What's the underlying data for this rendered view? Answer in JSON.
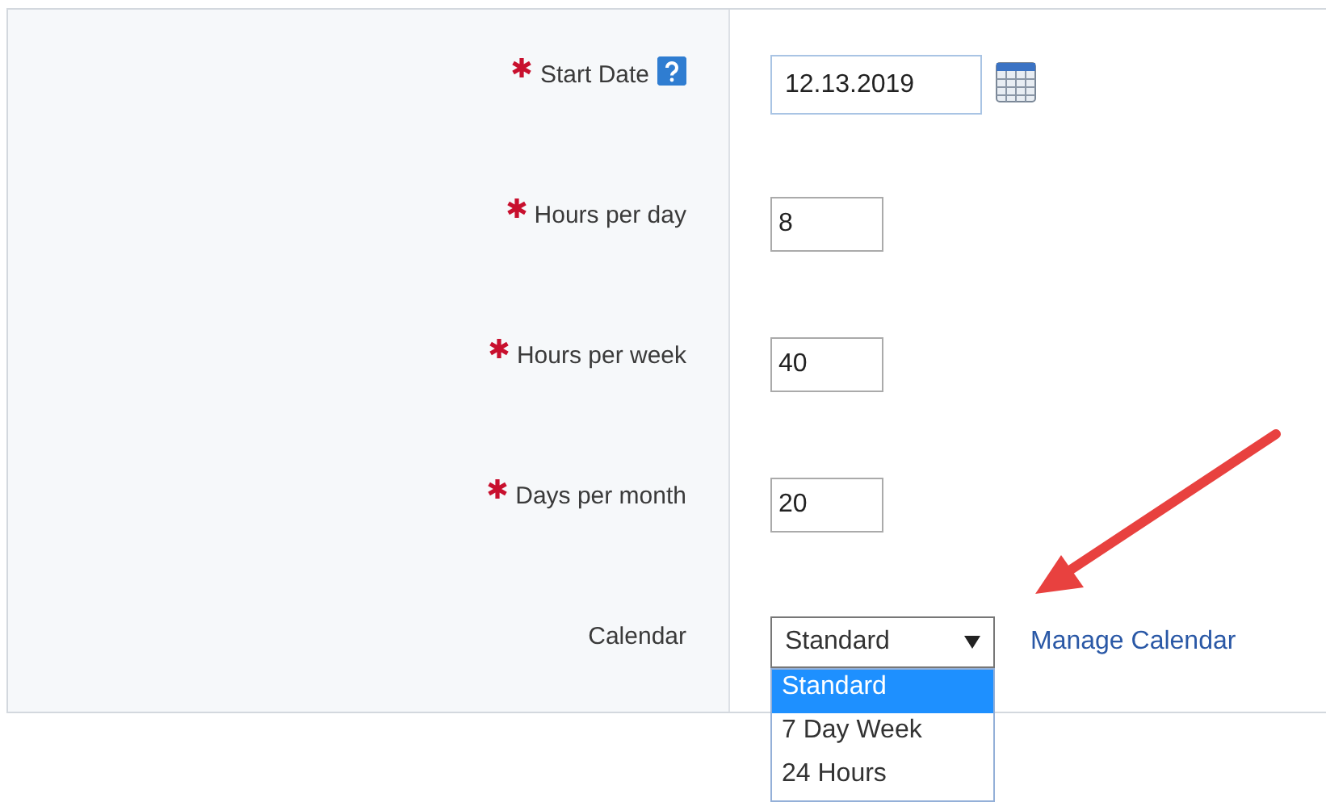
{
  "fields": [
    {
      "kind": "date",
      "label": "Start Date",
      "required": true,
      "help": true,
      "value": "12.13.2019"
    },
    {
      "kind": "text",
      "label": "Hours per day",
      "required": true,
      "help": false,
      "value": "8"
    },
    {
      "kind": "text",
      "label": "Hours per week",
      "required": true,
      "help": false,
      "value": "40"
    },
    {
      "kind": "text",
      "label": "Days per month",
      "required": true,
      "help": false,
      "value": "20"
    },
    {
      "kind": "select",
      "label": "Calendar",
      "required": false,
      "help": false,
      "value": "Standard",
      "expanded": true,
      "link": "Manage Calendar",
      "options": [
        {
          "label": "Standard",
          "selected": true
        },
        {
          "label": "7 Day Week",
          "selected": false
        },
        {
          "label": "24 Hours",
          "selected": false
        }
      ]
    }
  ]
}
